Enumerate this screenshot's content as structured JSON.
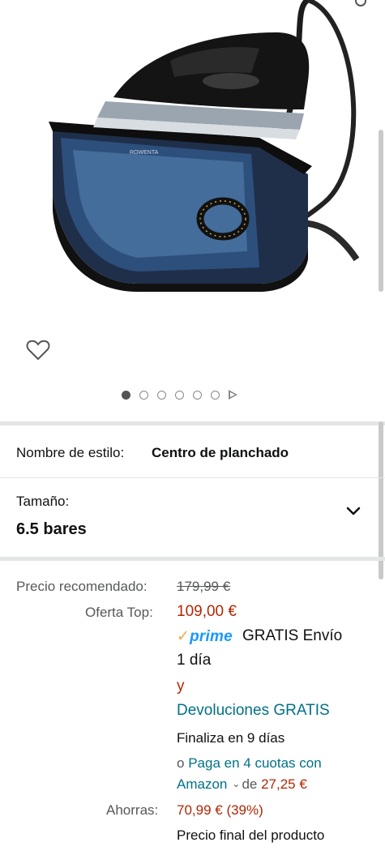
{
  "gallery": {
    "image_alt": "Centro de planchado Rowenta",
    "brand_mark": "ROWENTA",
    "dots_total": 6,
    "dots_active_index": 0
  },
  "style": {
    "label": "Nombre de estilo:",
    "value": "Centro de planchado"
  },
  "size": {
    "label": "Tamaño:",
    "value": "6.5 bares"
  },
  "pricing": {
    "recommended_label": "Precio recomendado:",
    "recommended_value": "179,99 €",
    "offer_label": "Oferta Top:",
    "offer_value": "109,00 €",
    "prime_check": "✓",
    "prime_text": "prime",
    "shipping_line1": "GRATIS Envío",
    "shipping_line2": "1 día",
    "and": "y",
    "returns": "Devoluciones GRATIS",
    "ends_in": "Finaliza en 9 días",
    "installments_prefix": "o",
    "installments_link_1": "Paga en 4 cuotas con",
    "installments_link_2": "Amazon",
    "installments_de": "de",
    "installments_amount": "27,25 €",
    "savings_label": "Ahorras:",
    "savings_value": "70,99 € (39%)",
    "final_price_note": "Precio final del producto"
  },
  "colors": {
    "price_red": "#b12704",
    "link_teal": "#007185",
    "prime_blue": "#1a98ff",
    "prime_orange": "#f3a847",
    "divider": "#e3e6e6"
  }
}
